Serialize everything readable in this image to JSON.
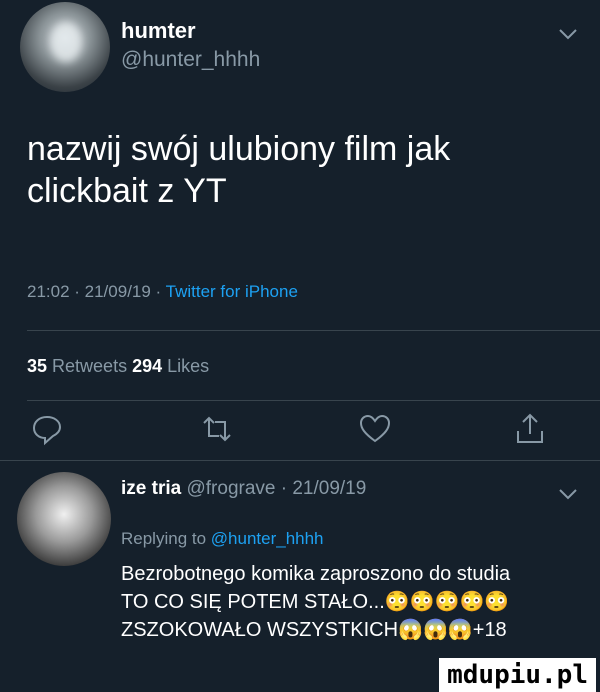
{
  "tweet": {
    "display_name": "humter",
    "handle": "@hunter_hhhh",
    "text": "nazwij swój ulubiony film jak\nclickbait z YT",
    "time": "21:02 · 21/09/19 · ",
    "app": "Twitter for iPhone",
    "retweets_count": "35",
    "retweets_label": " Retweets  ",
    "likes_count": "294",
    "likes_label": " Likes"
  },
  "actions": {
    "reply_icon": "comment-icon",
    "retweet_icon": "retweet-icon",
    "like_icon": "heart-icon",
    "share_icon": "share-icon"
  },
  "reply": {
    "display_name": "ize tria",
    "meta": " @frograve · 21/09/19",
    "replying_prefix": "Replying to ",
    "replying_to": "@hunter_hhhh",
    "text": "Bezrobotnego komika zaproszono do studia\nTO CO SIĘ POTEM STAŁO...😳😳😳😳😳\nZSZOKOWAŁO WSZYSTKICH😱😱😱+18"
  },
  "watermark": "mdupiu.pl",
  "colors": {
    "background": "#15202b",
    "secondary_text": "#8899a6",
    "link": "#1da1f2",
    "divider": "#38444d"
  }
}
